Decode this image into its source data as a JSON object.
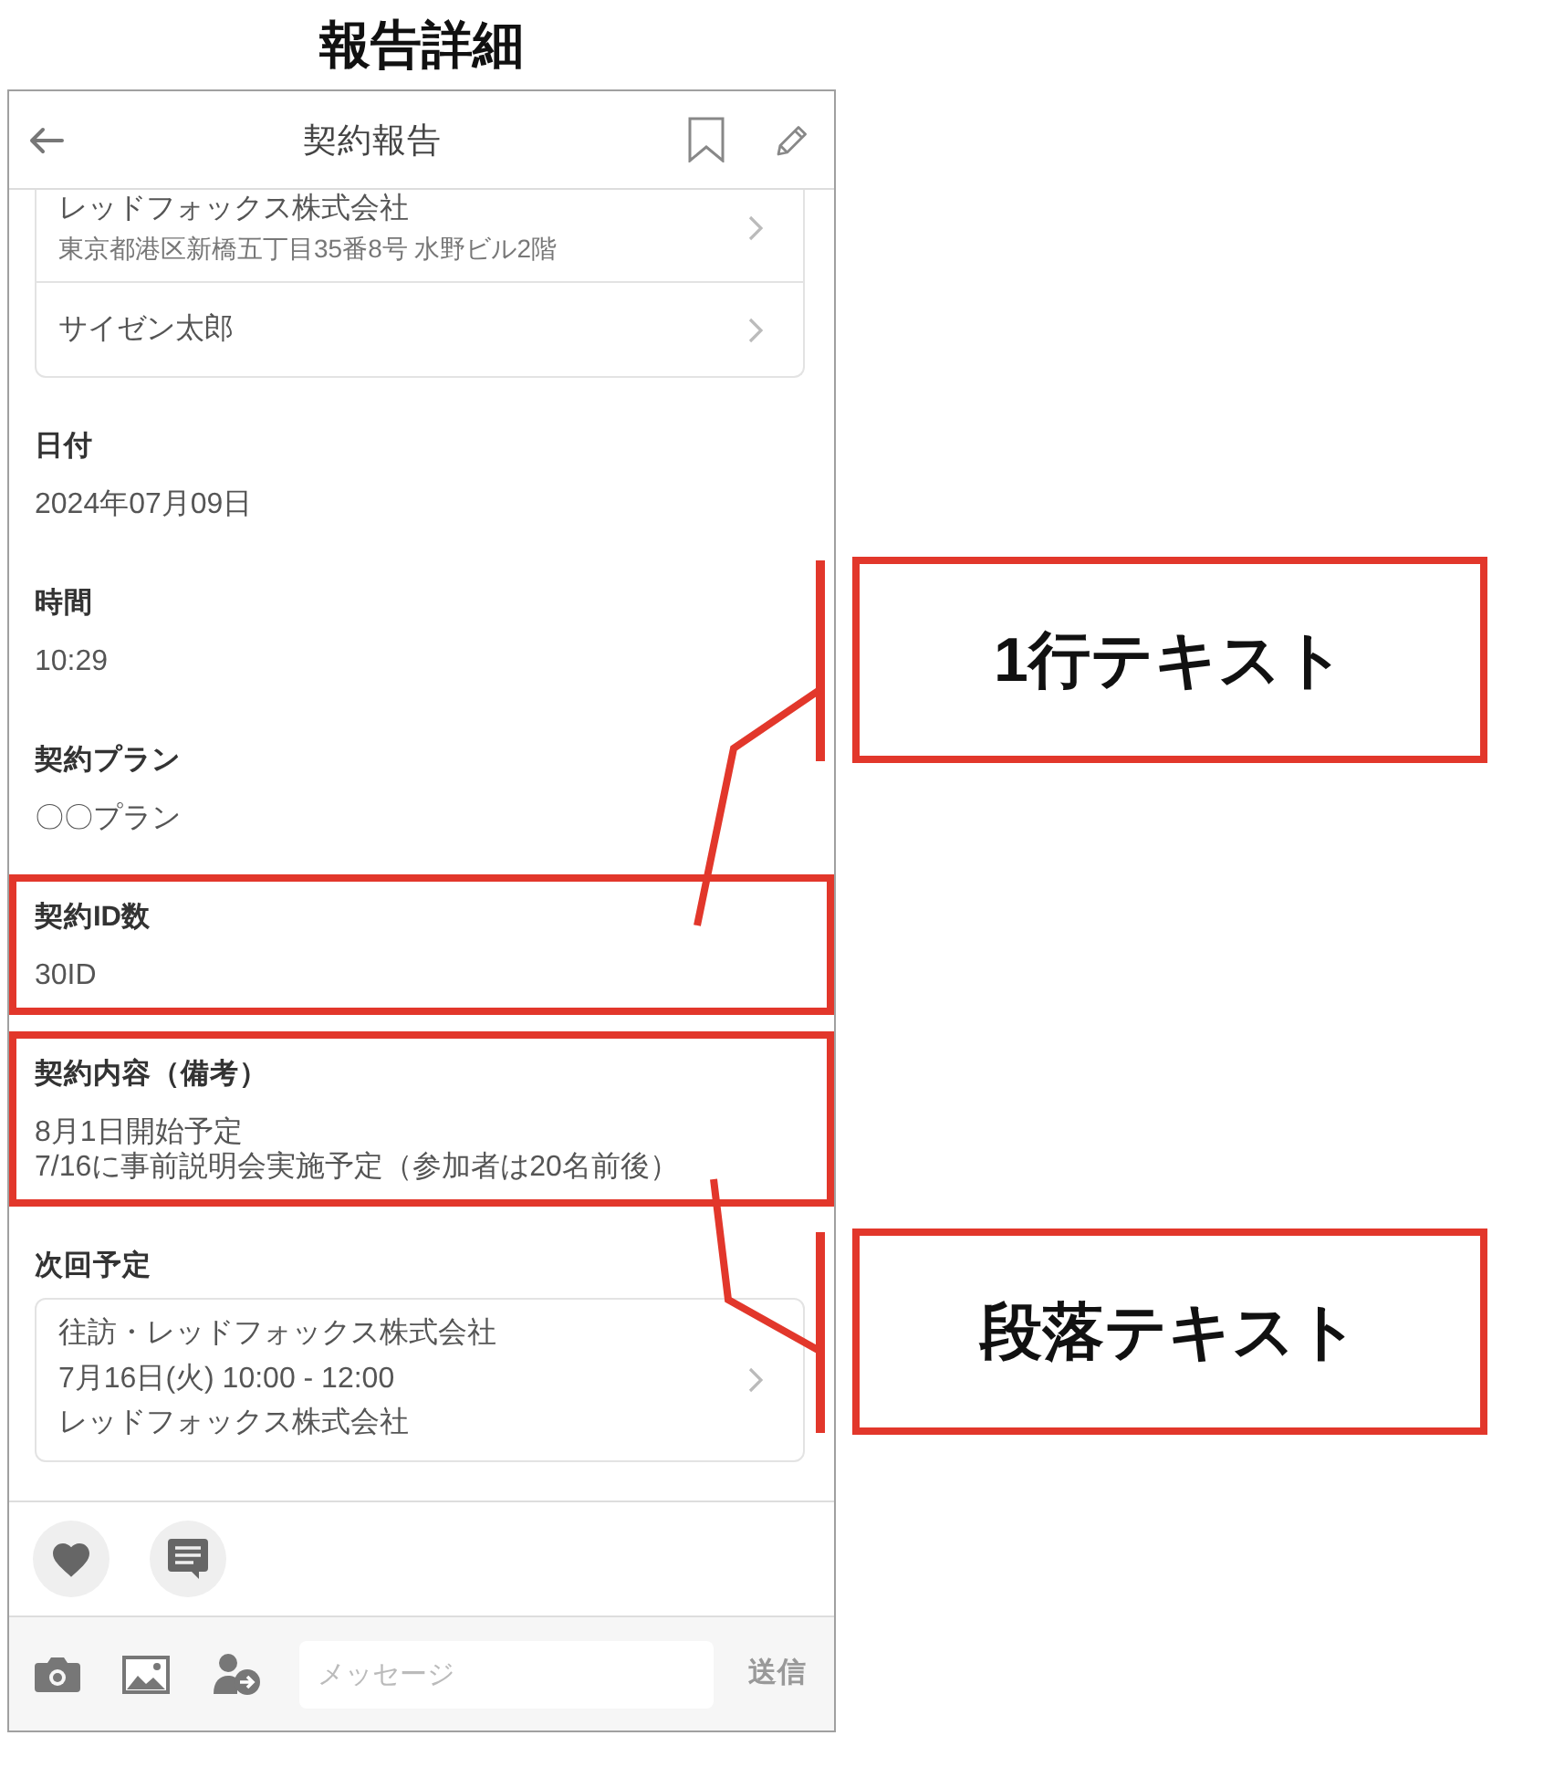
{
  "page_title": "報告詳細",
  "app_bar": {
    "title": "契約報告"
  },
  "contact_card": {
    "rows": [
      {
        "title": "レッドフォックス株式会社",
        "subtitle": "東京都港区新橋五丁目35番8号 水野ビル2階"
      },
      {
        "title": "サイゼン太郎"
      }
    ]
  },
  "fields": [
    {
      "label": "日付",
      "value": "2024年07月09日"
    },
    {
      "label": "時間",
      "value": "10:29"
    },
    {
      "label": "契約プラン",
      "value": "〇〇プラン"
    },
    {
      "label": "契約ID数",
      "value": "30ID",
      "callout": "1行テキスト"
    },
    {
      "label": "契約内容（備考）",
      "value": "8月1日開始予定\n7/16に事前説明会実施予定（参加者は20名前後）",
      "callout": "段落テキスト"
    }
  ],
  "next_schedule": {
    "label": "次回予定",
    "title": "往訪・レッドフォックス株式会社",
    "datetime": "7月16日(火) 10:00 - 12:00",
    "location": "レッドフォックス株式会社"
  },
  "composer": {
    "placeholder": "メッセージ",
    "send_label": "送信"
  }
}
